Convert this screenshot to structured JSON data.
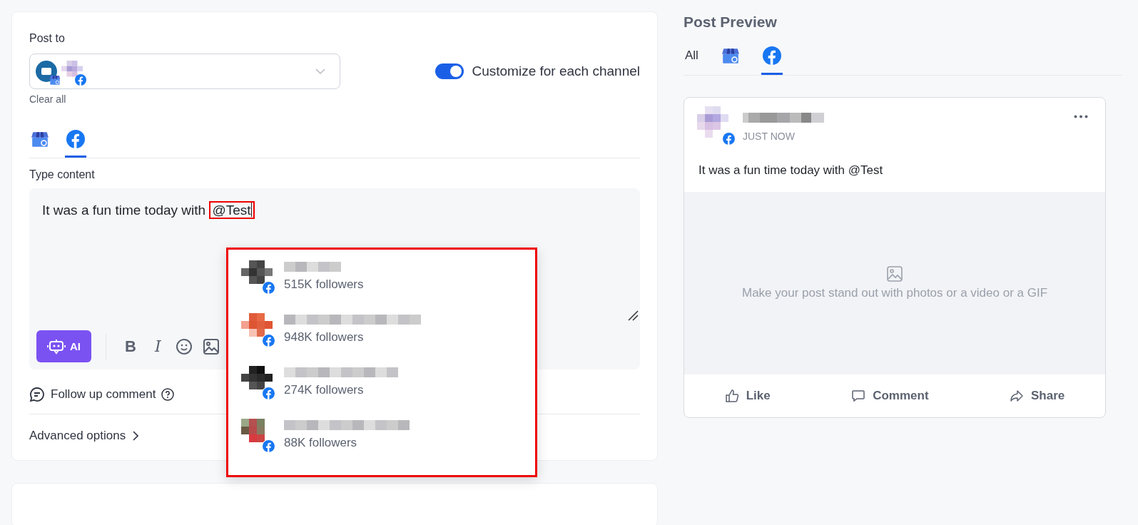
{
  "post_to": {
    "label": "Post to",
    "clear_label": "Clear all",
    "customize": {
      "label": "Customize for each channel",
      "on": true
    }
  },
  "channel_tabs": [
    {
      "kind": "google-business",
      "selected": false
    },
    {
      "kind": "facebook",
      "selected": true
    }
  ],
  "content": {
    "label": "Type content",
    "text": "It was a fun time today with",
    "mention": "@Test",
    "mention_highlighted": true
  },
  "toolbar": {
    "ai_label": "AI",
    "format_buttons": [
      {
        "kind": "bold",
        "label": "B"
      },
      {
        "kind": "italic",
        "label": "I"
      }
    ]
  },
  "mention_suggestions": {
    "highlighted": true,
    "items": [
      {
        "followers": "515K followers"
      },
      {
        "followers": "948K followers"
      },
      {
        "followers": "274K followers"
      },
      {
        "followers": "88K followers"
      }
    ]
  },
  "follow_up": {
    "label": "Follow up comment"
  },
  "advanced": {
    "label": "Advanced options"
  },
  "preview": {
    "title": "Post Preview",
    "tabs": [
      {
        "kind": "all",
        "label": "All",
        "selected": false
      },
      {
        "kind": "google-business",
        "selected": false
      },
      {
        "kind": "facebook",
        "selected": true
      }
    ],
    "time": "JUST NOW",
    "text": "It was a fun time today with @Test",
    "media_hint": "Make your post stand out with photos or a video or a GIF",
    "actions": [
      {
        "kind": "like",
        "label": "Like"
      },
      {
        "kind": "comment",
        "label": "Comment"
      },
      {
        "kind": "share",
        "label": "Share"
      }
    ]
  }
}
